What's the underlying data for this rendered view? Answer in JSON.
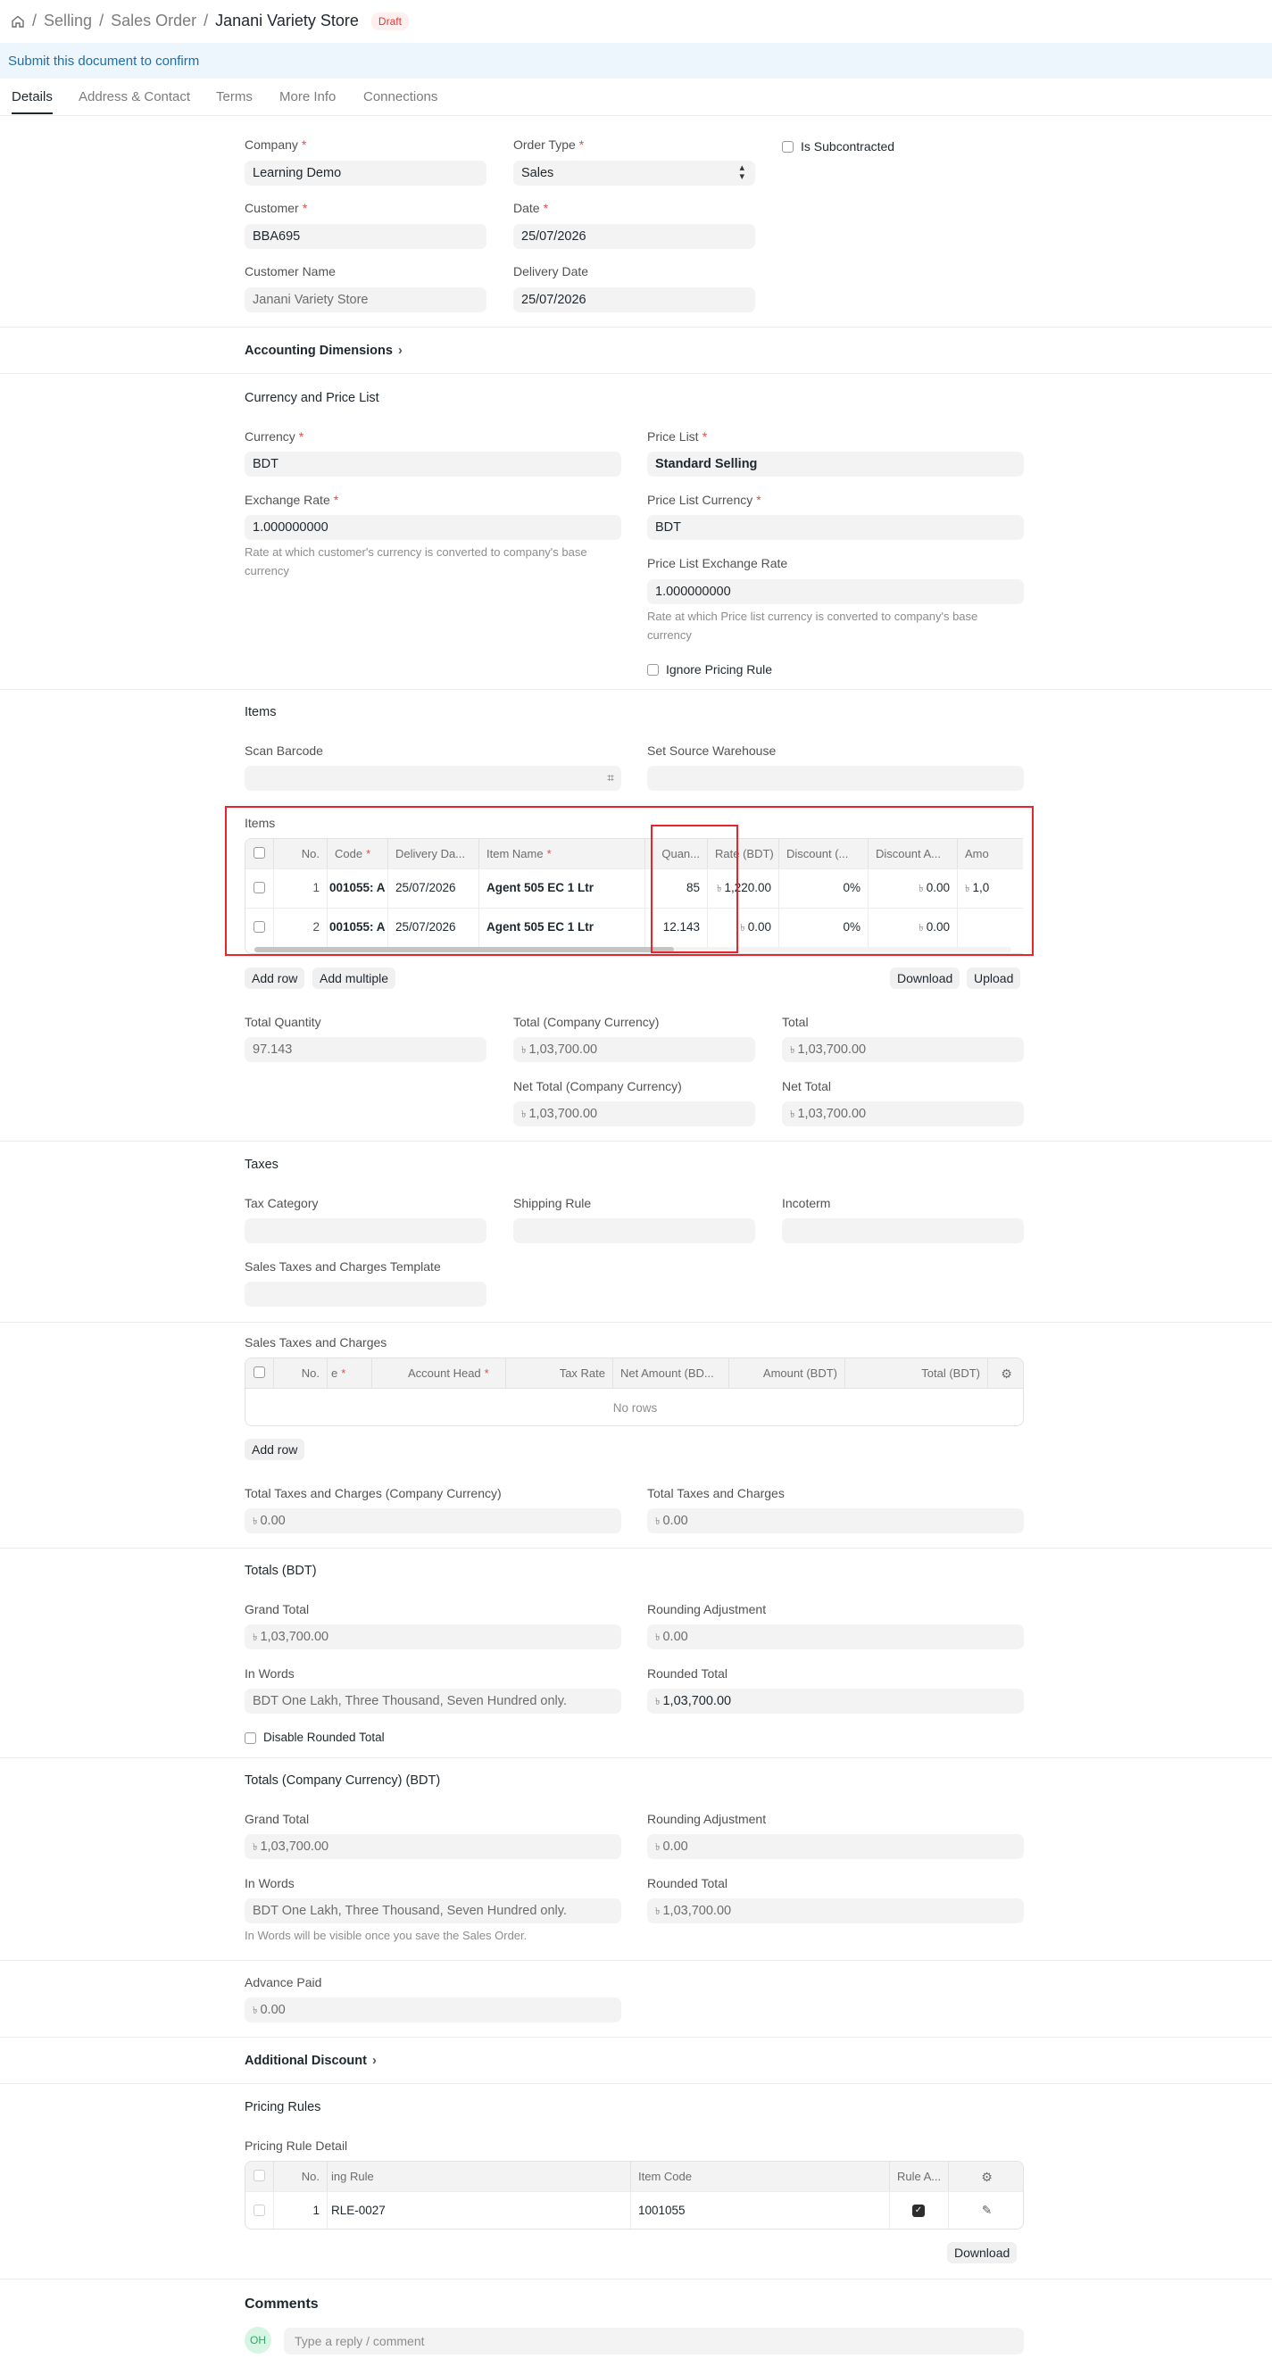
{
  "breadcrumb": {
    "home_icon": "home-icon",
    "items": [
      "Selling",
      "Sales Order"
    ],
    "current": "Janani Variety Store",
    "status": "Draft"
  },
  "banner": "Submit this document to confirm",
  "tabs": [
    "Details",
    "Address & Contact",
    "Terms",
    "More Info",
    "Connections"
  ],
  "header_fields": {
    "company": {
      "label": "Company",
      "value": "Learning Demo"
    },
    "order_type": {
      "label": "Order Type",
      "value": "Sales"
    },
    "is_subcontracted": "Is Subcontracted",
    "customer": {
      "label": "Customer",
      "value": "BBA695"
    },
    "date": {
      "label": "Date",
      "value": "25/07/2026"
    },
    "customer_name": {
      "label": "Customer Name",
      "value": "Janani Variety Store"
    },
    "delivery_date": {
      "label": "Delivery Date",
      "value": "25/07/2026"
    }
  },
  "accounting_dimensions": "Accounting Dimensions",
  "currency_section": {
    "title": "Currency and Price List",
    "currency": {
      "label": "Currency",
      "value": "BDT"
    },
    "price_list": {
      "label": "Price List",
      "value": "Standard Selling"
    },
    "exchange_rate": {
      "label": "Exchange Rate",
      "value": "1.000000000",
      "desc": "Rate at which customer's currency is converted to company's base currency"
    },
    "price_list_currency": {
      "label": "Price List Currency",
      "value": "BDT"
    },
    "plc_exchange_rate": {
      "label": "Price List Exchange Rate",
      "value": "1.000000000",
      "desc": "Rate at which Price list currency is converted to company's base currency"
    },
    "ignore_pricing_rule": "Ignore Pricing Rule"
  },
  "items_section": {
    "title": "Items",
    "scan_barcode": "Scan Barcode",
    "set_source_warehouse": "Set Source Warehouse",
    "table_label": "Items",
    "columns": [
      "No.",
      "Code",
      "Delivery Da...",
      "Item Name",
      "Quan...",
      "Rate (BDT)",
      "Discount (...",
      "Discount A...",
      "Amo"
    ],
    "rows": [
      {
        "no": "1",
        "code": "001055: A",
        "delivery": "25/07/2026",
        "item_name": "Agent 505 EC 1 Ltr",
        "qty": "85",
        "rate": "1,220.00",
        "disc_pct": "0%",
        "disc_amt": "0.00",
        "amount": "1,0"
      },
      {
        "no": "2",
        "code": "001055: A",
        "delivery": "25/07/2026",
        "item_name": "Agent 505 EC 1 Ltr",
        "qty": "12.143",
        "rate": "0.00",
        "disc_pct": "0%",
        "disc_amt": "0.00",
        "amount": ""
      }
    ],
    "add_row": "Add row",
    "add_multiple": "Add multiple",
    "download": "Download",
    "upload": "Upload",
    "total_quantity": {
      "label": "Total Quantity",
      "value": "97.143"
    },
    "total_company": {
      "label": "Total (Company Currency)",
      "value": "1,03,700.00"
    },
    "total": {
      "label": "Total",
      "value": "1,03,700.00"
    },
    "net_total_company": {
      "label": "Net Total (Company Currency)",
      "value": "1,03,700.00"
    },
    "net_total": {
      "label": "Net Total",
      "value": "1,03,700.00"
    }
  },
  "taxes_section": {
    "title": "Taxes",
    "tax_category": "Tax Category",
    "shipping_rule": "Shipping Rule",
    "incoterm": "Incoterm",
    "template": "Sales Taxes and Charges Template",
    "table_label": "Sales Taxes and Charges",
    "columns": [
      "No.",
      "e",
      "Account Head",
      "Tax Rate",
      "Net Amount (BD...",
      "Amount (BDT)",
      "Total (BDT)"
    ],
    "no_rows": "No rows",
    "add_row": "Add row",
    "total_company": {
      "label": "Total Taxes and Charges (Company Currency)",
      "value": "0.00"
    },
    "total": {
      "label": "Total Taxes and Charges",
      "value": "0.00"
    }
  },
  "totals_bdt": {
    "title": "Totals (BDT)",
    "grand_total": {
      "label": "Grand Total",
      "value": "1,03,700.00"
    },
    "rounding_adjustment": {
      "label": "Rounding Adjustment",
      "value": "0.00"
    },
    "in_words": {
      "label": "In Words",
      "value": "BDT One Lakh, Three Thousand, Seven Hundred only."
    },
    "rounded_total": {
      "label": "Rounded Total",
      "value": "1,03,700.00"
    },
    "disable_rounded": "Disable Rounded Total"
  },
  "totals_company": {
    "title": "Totals (Company Currency) (BDT)",
    "grand_total": {
      "label": "Grand Total",
      "value": "1,03,700.00"
    },
    "rounding_adjustment": {
      "label": "Rounding Adjustment",
      "value": "0.00"
    },
    "in_words": {
      "label": "In Words",
      "value": "BDT One Lakh, Three Thousand, Seven Hundred only.",
      "desc": "In Words will be visible once you save the Sales Order."
    },
    "rounded_total": {
      "label": "Rounded Total",
      "value": "1,03,700.00"
    }
  },
  "advance_paid": {
    "label": "Advance Paid",
    "value": "0.00"
  },
  "additional_discount": "Additional Discount",
  "pricing_rules": {
    "title": "Pricing Rules",
    "table_label": "Pricing Rule Detail",
    "columns": [
      "No.",
      "ing Rule",
      "Item Code",
      "Rule A..."
    ],
    "row": {
      "no": "1",
      "rule": "RLE-0027",
      "item_code": "1001055"
    },
    "download": "Download"
  },
  "comments": {
    "title": "Comments",
    "avatar": "OH",
    "placeholder": "Type a reply / comment"
  },
  "currency_symbol": "৳"
}
